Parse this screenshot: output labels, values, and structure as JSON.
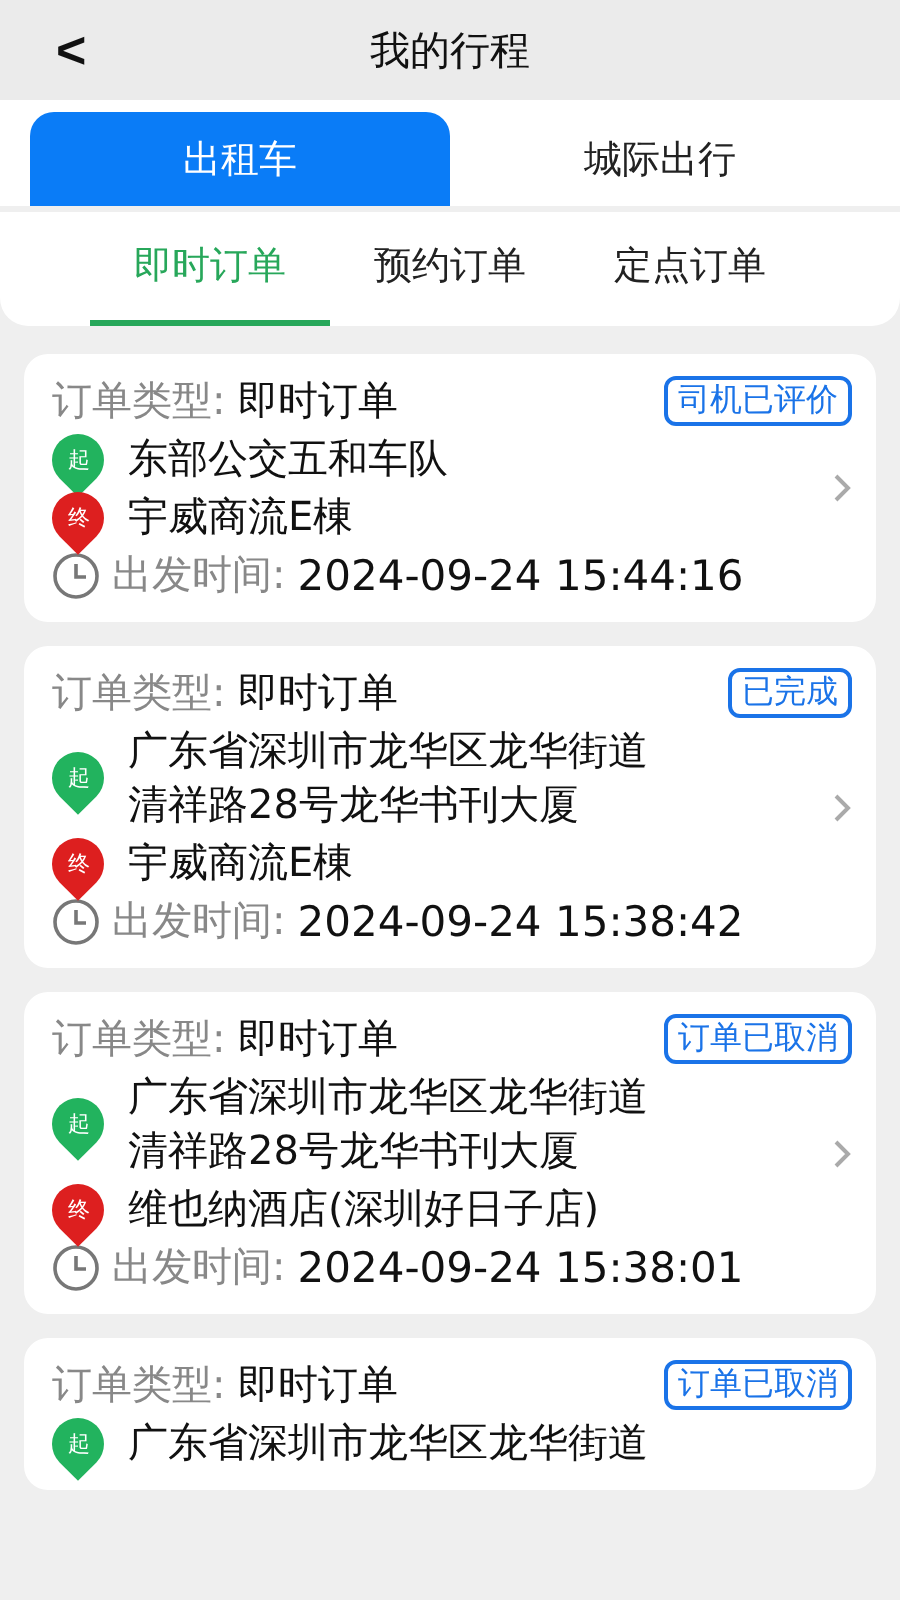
{
  "header": {
    "back": "<",
    "title": "我的行程"
  },
  "tabs": [
    {
      "label": "出租车",
      "selected": true
    },
    {
      "label": "城际出行",
      "selected": false
    }
  ],
  "subtabs": [
    {
      "label": "即时订单",
      "selected": true
    },
    {
      "label": "预约订单",
      "selected": false
    },
    {
      "label": "定点订单",
      "selected": false
    }
  ],
  "orders": [
    {
      "type_label": "订单类型:",
      "type": "即时订单",
      "status": "司机已评价",
      "from_pin": "起",
      "from": [
        "东部公交五和车队"
      ],
      "to_pin": "终",
      "to": "宇威商流E棟",
      "time_label": "出发时间:",
      "time": "2024-09-24 15:44:16"
    },
    {
      "type_label": "订单类型:",
      "type": "即时订单",
      "status": "已完成",
      "from_pin": "起",
      "from": [
        "广东省深圳市龙华区龙华街道",
        "清祥路28号龙华书刊大厦"
      ],
      "to_pin": "终",
      "to": "宇威商流E棟",
      "time_label": "出发时间:",
      "time": "2024-09-24 15:38:42"
    },
    {
      "type_label": "订单类型:",
      "type": "即时订单",
      "status": "订单已取消",
      "from_pin": "起",
      "from": [
        "广东省深圳市龙华区龙华街道",
        "清祥路28号龙华书刊大厦"
      ],
      "to_pin": "终",
      "to": "维也纳酒店(深圳好日子店)",
      "time_label": "出发时间:",
      "time": "2024-09-24 15:38:01"
    },
    {
      "type_label": "订单类型:",
      "type": "即时订单",
      "status": "订单已取消",
      "from_pin": "起",
      "from": [
        "广东省深圳市龙华区龙华街道"
      ]
    }
  ]
}
